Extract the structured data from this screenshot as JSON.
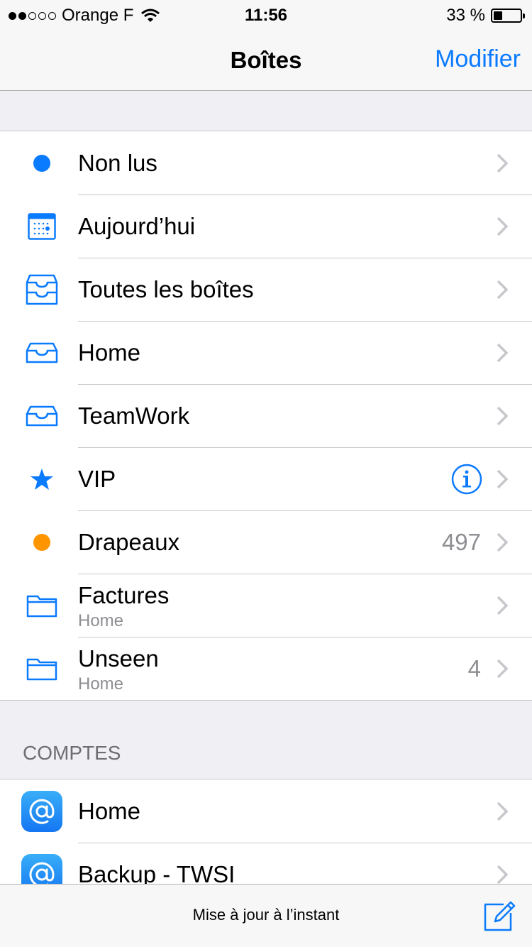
{
  "status_bar": {
    "carrier": "Orange F",
    "time": "11:56",
    "battery_text": "33 %",
    "battery_level": 0.33,
    "signal_bars_filled": 2,
    "signal_bars_total": 5
  },
  "nav": {
    "title": "Boîtes",
    "edit_label": "Modifier"
  },
  "mailboxes": [
    {
      "label": "Non lus",
      "icon": "unread-dot-icon"
    },
    {
      "label": "Aujourd’hui",
      "icon": "calendar-icon"
    },
    {
      "label": "Toutes les boîtes",
      "icon": "all-inboxes-icon"
    },
    {
      "label": "Home",
      "icon": "inbox-tray-icon"
    },
    {
      "label": "TeamWork",
      "icon": "inbox-tray-icon"
    },
    {
      "label": "VIP",
      "icon": "star-icon"
    },
    {
      "label": "Drapeaux",
      "icon": "flag-dot-icon",
      "count": "497"
    },
    {
      "label": "Factures",
      "sublabel": "Home",
      "icon": "folder-icon"
    },
    {
      "label": "Unseen",
      "sublabel": "Home",
      "icon": "folder-icon",
      "count": "4"
    }
  ],
  "accounts_header": "COMPTES",
  "accounts": [
    {
      "label": "Home",
      "icon": "at-sign-icon"
    },
    {
      "label": "Backup - TWSI",
      "icon": "at-sign-icon"
    }
  ],
  "toolbar": {
    "status": "Mise à jour à l’instant"
  },
  "colors": {
    "accent": "#0a7aff",
    "flag": "#ff9500",
    "background": "#efeff4",
    "secondary_text": "#8e8e93"
  }
}
